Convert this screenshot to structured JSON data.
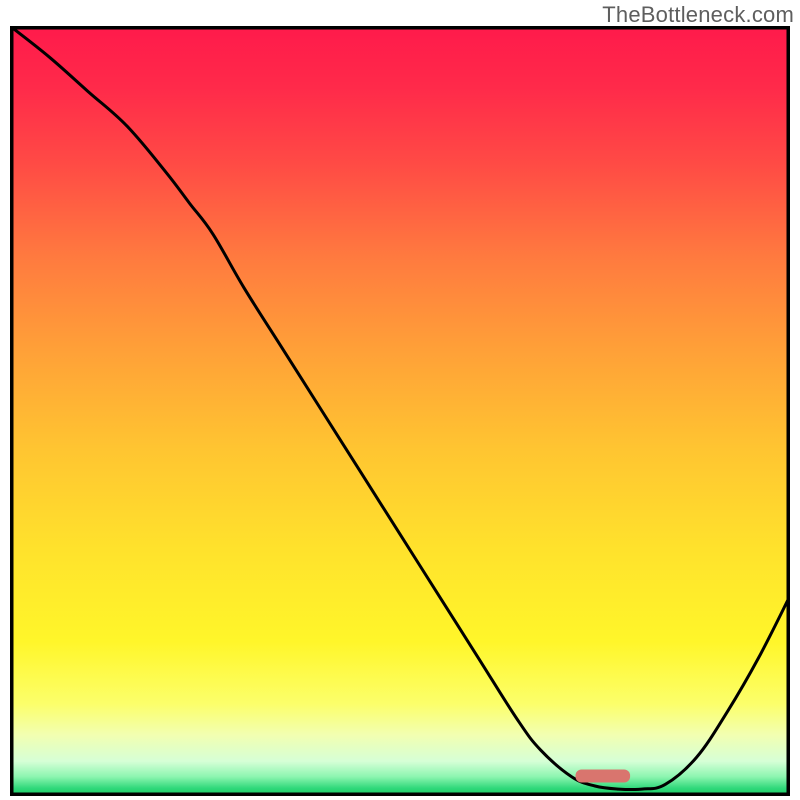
{
  "watermark": "TheBottleneck.com",
  "chart_data": {
    "type": "line",
    "title": "",
    "xlabel": "",
    "ylabel": "",
    "xlim": [
      0,
      100
    ],
    "ylim": [
      0,
      100
    ],
    "series": [
      {
        "name": "curve",
        "x": [
          0,
          5,
          10,
          15,
          20,
          23,
          26,
          30,
          35,
          40,
          45,
          50,
          55,
          60,
          65,
          68,
          72,
          75,
          78,
          81,
          84,
          88,
          92,
          96,
          100
        ],
        "values": [
          100,
          96,
          91.5,
          87,
          81,
          77,
          73,
          66,
          58,
          50,
          42,
          34,
          26,
          18,
          10,
          6,
          2.5,
          1.3,
          0.9,
          0.9,
          1.5,
          5,
          11,
          18,
          26
        ]
      }
    ],
    "marker": {
      "x_center": 76,
      "y": 2.6,
      "x_width": 7,
      "color": "#d9756e"
    },
    "gradient_stops": [
      {
        "offset": 0.0,
        "color": "#ff1a4b"
      },
      {
        "offset": 0.08,
        "color": "#ff2a4a"
      },
      {
        "offset": 0.18,
        "color": "#ff4b45"
      },
      {
        "offset": 0.3,
        "color": "#ff7a3f"
      },
      {
        "offset": 0.42,
        "color": "#ffa038"
      },
      {
        "offset": 0.55,
        "color": "#ffc531"
      },
      {
        "offset": 0.68,
        "color": "#ffe22c"
      },
      {
        "offset": 0.8,
        "color": "#fff62a"
      },
      {
        "offset": 0.88,
        "color": "#fcff6a"
      },
      {
        "offset": 0.92,
        "color": "#f2ffb0"
      },
      {
        "offset": 0.955,
        "color": "#d6ffd6"
      },
      {
        "offset": 0.975,
        "color": "#8cf5b0"
      },
      {
        "offset": 0.99,
        "color": "#2fd87a"
      },
      {
        "offset": 1.0,
        "color": "#18c862"
      }
    ],
    "border_color": "#000000",
    "border_width": 7,
    "line_color": "#000000",
    "line_width": 3
  }
}
